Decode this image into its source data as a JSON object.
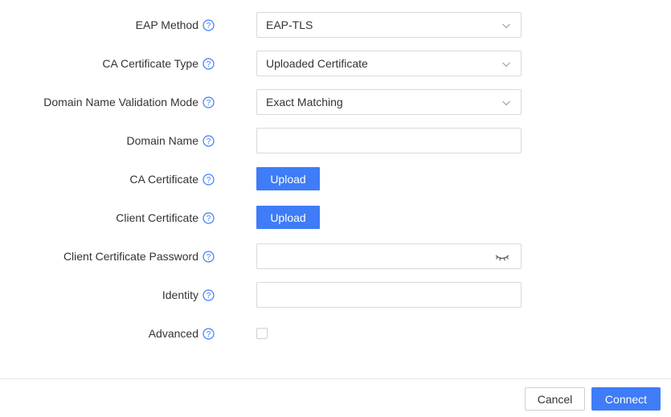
{
  "form": {
    "eap_method": {
      "label": "EAP Method",
      "value": "EAP-TLS"
    },
    "ca_certificate_type": {
      "label": "CA Certificate Type",
      "value": "Uploaded Certificate"
    },
    "domain_validation_mode": {
      "label": "Domain Name Validation Mode",
      "value": "Exact Matching"
    },
    "domain_name": {
      "label": "Domain Name",
      "value": ""
    },
    "ca_certificate": {
      "label": "CA Certificate",
      "button": "Upload"
    },
    "client_certificate": {
      "label": "Client Certificate",
      "button": "Upload"
    },
    "client_certificate_password": {
      "label": "Client Certificate Password",
      "value": ""
    },
    "identity": {
      "label": "Identity",
      "value": ""
    },
    "advanced": {
      "label": "Advanced",
      "checked": false
    }
  },
  "footer": {
    "cancel_label": "Cancel",
    "connect_label": "Connect"
  },
  "colors": {
    "primary": "#3f7cf7",
    "help_icon": "#3f7cf7",
    "border": "#d9d9d9"
  },
  "icons": {
    "help": "question-circle-icon",
    "dropdown": "chevron-down-icon",
    "password_toggle": "eye-closed-icon"
  }
}
